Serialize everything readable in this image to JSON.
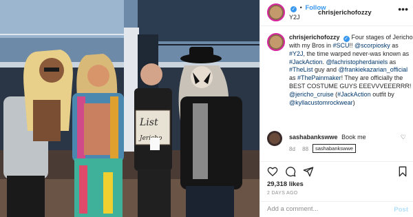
{
  "post": {
    "image_alt": "Five people in costume posing on a cruise ship deck",
    "sign_text_line1": "List",
    "sign_text_line2": "Jericho"
  },
  "header": {
    "username": "chrisjerichofozzy",
    "verified_symbol": "✓",
    "separator": "•",
    "follow_label": "Follow",
    "subtitle": "Y2J",
    "more_symbol": "•••"
  },
  "caption": {
    "username": "chrisjerichofozzy",
    "verified_symbol": "✓",
    "parts": [
      {
        "text": "Four stages of Jericho with my Bros in ",
        "link": false
      },
      {
        "text": "#SCU",
        "link": true
      },
      {
        "text": "!! ",
        "link": false
      },
      {
        "text": "@scorpiosky",
        "link": true
      },
      {
        "text": " as ",
        "link": false
      },
      {
        "text": "#Y2J",
        "link": true
      },
      {
        "text": ", the time warped never-was known as ",
        "link": false
      },
      {
        "text": "#JackAction",
        "link": true
      },
      {
        "text": ". ",
        "link": false
      },
      {
        "text": "@fachristopherdaniels",
        "link": true
      },
      {
        "text": " as ",
        "link": false
      },
      {
        "text": "#TheList",
        "link": true
      },
      {
        "text": " guy and ",
        "link": false
      },
      {
        "text": "@frankiekazarian_official",
        "link": true
      },
      {
        "text": " as ",
        "link": false
      },
      {
        "text": "#ThePainmaker",
        "link": true
      },
      {
        "text": "! They are officially the BEST COSTUME GUYS EEEVVVEEERRR! ",
        "link": false
      },
      {
        "text": "@jericho_cruise",
        "link": true
      },
      {
        "text": " (",
        "link": false
      },
      {
        "text": "#JackAction",
        "link": true
      },
      {
        "text": " outfit by ",
        "link": false
      },
      {
        "text": "@kyllacustomrockwear",
        "link": true
      },
      {
        "text": ")",
        "link": false
      }
    ]
  },
  "comment": {
    "username": "sashabankswwe",
    "text": "Book me",
    "time": "8d",
    "likes_partial": "88",
    "tooltip": "sashabankswwe",
    "like_symbol": "♡"
  },
  "actions": {
    "likes": "29,318 likes",
    "date": "2 DAYS AGO"
  },
  "add_comment": {
    "placeholder": "Add a comment...",
    "post_label": "Post"
  },
  "colors": {
    "link": "#00376b",
    "follow": "#3897f0",
    "post_disabled": "#b2dffc",
    "verified": "#3897f0"
  }
}
